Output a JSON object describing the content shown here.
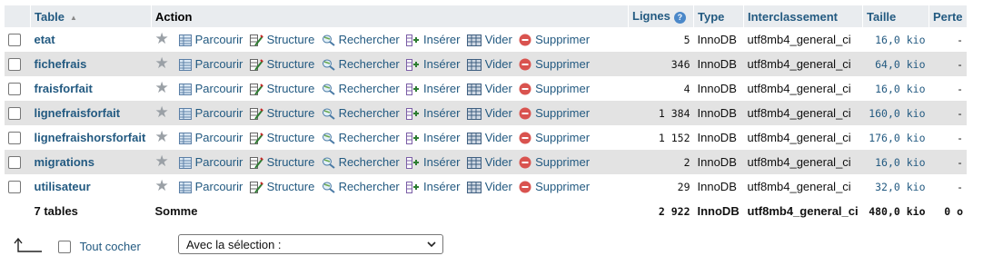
{
  "header": {
    "table": "Table",
    "action": "Action",
    "lignes": "Lignes",
    "type": "Type",
    "interclassement": "Interclassement",
    "taille": "Taille",
    "perte": "Perte"
  },
  "actions": {
    "parcourir": "Parcourir",
    "structure": "Structure",
    "rechercher": "Rechercher",
    "inserer": "Insérer",
    "vider": "Vider",
    "supprimer": "Supprimer"
  },
  "rows": [
    {
      "name": "etat",
      "lignes": "5",
      "type": "InnoDB",
      "coll": "utf8mb4_general_ci",
      "taille": "16,0 kio",
      "perte": "-"
    },
    {
      "name": "fichefrais",
      "lignes": "346",
      "type": "InnoDB",
      "coll": "utf8mb4_general_ci",
      "taille": "64,0 kio",
      "perte": "-"
    },
    {
      "name": "fraisforfait",
      "lignes": "4",
      "type": "InnoDB",
      "coll": "utf8mb4_general_ci",
      "taille": "16,0 kio",
      "perte": "-"
    },
    {
      "name": "lignefraisforfait",
      "lignes": "1 384",
      "type": "InnoDB",
      "coll": "utf8mb4_general_ci",
      "taille": "160,0 kio",
      "perte": "-"
    },
    {
      "name": "lignefraishorsforfait",
      "lignes": "1 152",
      "type": "InnoDB",
      "coll": "utf8mb4_general_ci",
      "taille": "176,0 kio",
      "perte": "-"
    },
    {
      "name": "migrations",
      "lignes": "2",
      "type": "InnoDB",
      "coll": "utf8mb4_general_ci",
      "taille": "16,0 kio",
      "perte": "-"
    },
    {
      "name": "utilisateur",
      "lignes": "29",
      "type": "InnoDB",
      "coll": "utf8mb4_general_ci",
      "taille": "32,0 kio",
      "perte": "-"
    }
  ],
  "summary": {
    "tables": "7 tables",
    "somme": "Somme",
    "lignes": "2 922",
    "type": "InnoDB",
    "coll": "utf8mb4_general_ci",
    "taille": "480,0 kio",
    "perte": "0 o"
  },
  "footer": {
    "tout_cocher": "Tout cocher",
    "selection": "Avec la sélection :"
  }
}
